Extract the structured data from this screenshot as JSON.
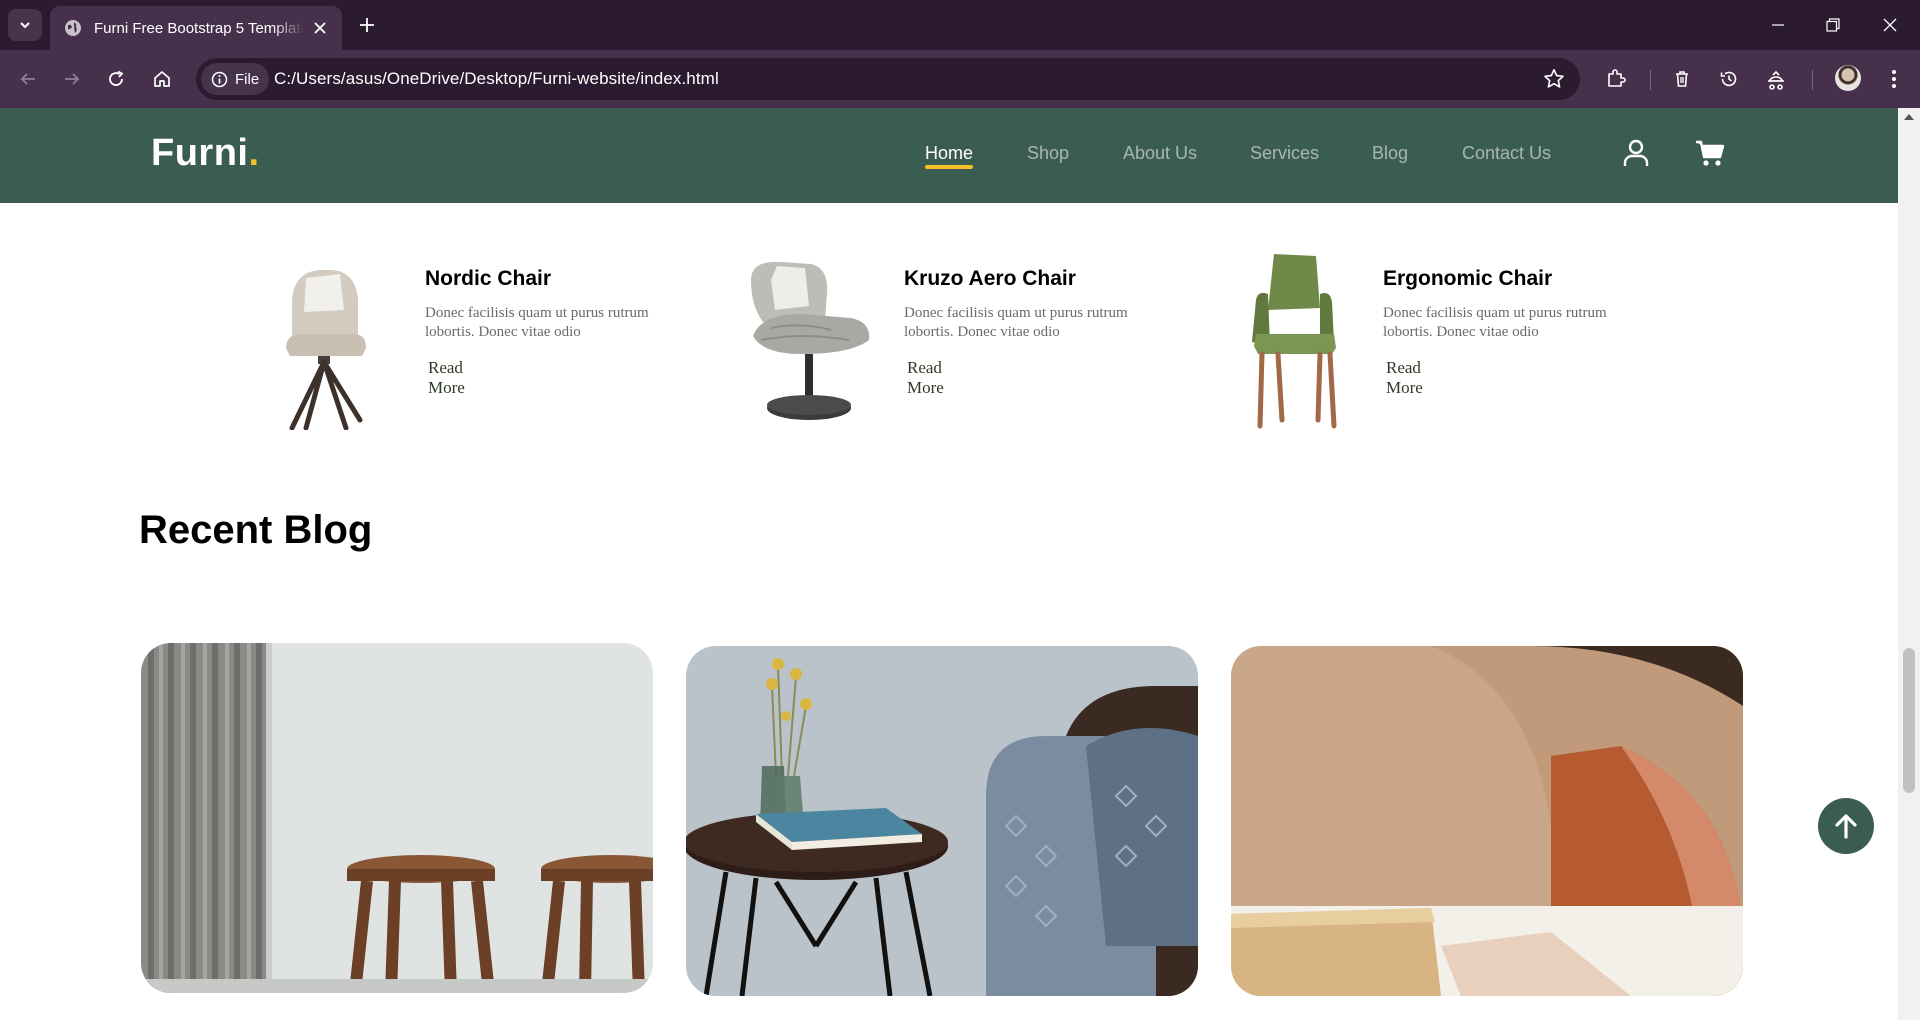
{
  "browser": {
    "tab_title": "Furni Free Bootstrap 5 Template",
    "file_chip_label": "File",
    "url": "C:/Users/asus/OneDrive/Desktop/Furni-website/index.html",
    "icons": [
      "tab-menu-icon",
      "globe-icon",
      "close-icon",
      "plus-icon",
      "minimize-icon",
      "restore-icon",
      "close-window-icon",
      "back-icon",
      "forward-icon",
      "reload-icon",
      "home-icon",
      "info-icon",
      "star-icon",
      "extensions-icon",
      "trash-icon",
      "history-icon",
      "extension-puzzle-icon",
      "more-icon"
    ]
  },
  "site": {
    "brand": "Furni",
    "brand_dot": ".",
    "colors": {
      "nav_bg": "#3b5d50",
      "accent": "#f9bf29"
    },
    "nav": {
      "items": [
        {
          "label": "Home",
          "active": true
        },
        {
          "label": "Shop",
          "active": false
        },
        {
          "label": "About Us",
          "active": false
        },
        {
          "label": "Services",
          "active": false
        },
        {
          "label": "Blog",
          "active": false
        },
        {
          "label": "Contact Us",
          "active": false
        }
      ],
      "icons": [
        "user-icon",
        "cart-icon"
      ]
    }
  },
  "products": [
    {
      "title": "Nordic Chair",
      "desc": "Donec facilisis quam ut purus rutrum lobortis. Donec vitae odio",
      "link": "Read More"
    },
    {
      "title": "Kruzo Aero Chair",
      "desc": "Donec facilisis quam ut purus rutrum lobortis. Donec vitae odio",
      "link": "Read More"
    },
    {
      "title": "Ergonomic Chair",
      "desc": "Donec facilisis quam ut purus rutrum lobortis. Donec vitae odio",
      "link": "Read More"
    }
  ],
  "blog": {
    "heading": "Recent Blog"
  }
}
